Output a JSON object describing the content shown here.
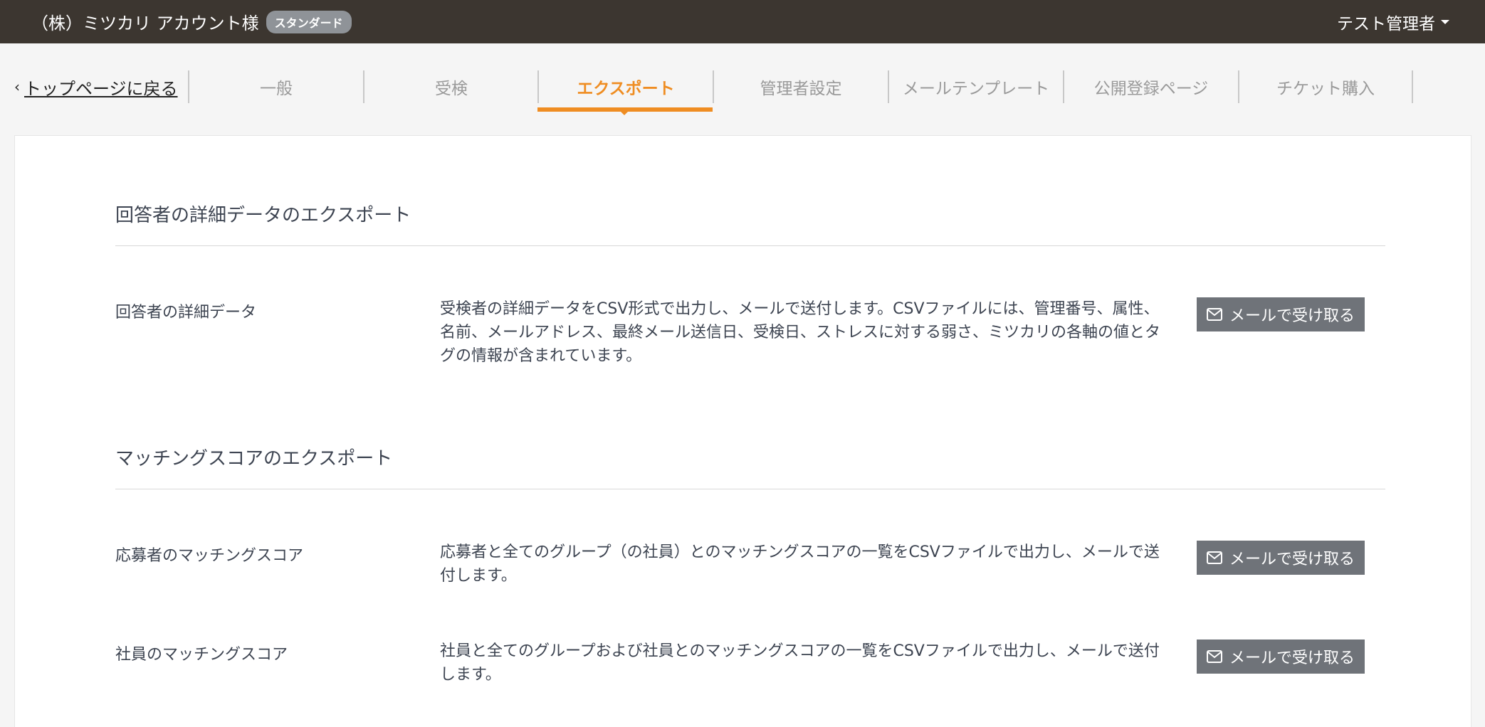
{
  "header": {
    "company": "（株）ミツカリ アカウント様",
    "plan_badge": "スタンダード",
    "user_name": "テスト管理者"
  },
  "nav": {
    "back_label": "トップページに戻る",
    "tabs": [
      {
        "label": "一般"
      },
      {
        "label": "受検"
      },
      {
        "label": "エクスポート",
        "active": true
      },
      {
        "label": "管理者設定"
      },
      {
        "label": "メールテンプレート"
      },
      {
        "label": "公開登録ページ"
      },
      {
        "label": "チケット購入"
      }
    ]
  },
  "sections": [
    {
      "title": "回答者の詳細データのエクスポート",
      "rows": [
        {
          "label": "回答者の詳細データ",
          "desc": "受検者の詳細データをCSV形式で出力し、メールで送付します。CSVファイルには、管理番号、属性、名前、メールアドレス、最終メール送信日、受検日、ストレスに対する弱さ、ミツカリの各軸の値とタグの情報が含まれています。",
          "button": "メールで受け取る"
        }
      ]
    },
    {
      "title": "マッチングスコアのエクスポート",
      "rows": [
        {
          "label": "応募者のマッチングスコア",
          "desc": "応募者と全てのグループ（の社員）とのマッチングスコアの一覧をCSVファイルで出力し、メールで送付します。",
          "button": "メールで受け取る"
        },
        {
          "label": "社員のマッチングスコア",
          "desc": "社員と全てのグループおよび社員とのマッチングスコアの一覧をCSVファイルで出力し、メールで送付します。",
          "button": "メールで受け取る"
        }
      ]
    }
  ],
  "colors": {
    "header_bg": "#3c3630",
    "accent": "#ef8d22",
    "button_bg": "#6f7379"
  }
}
